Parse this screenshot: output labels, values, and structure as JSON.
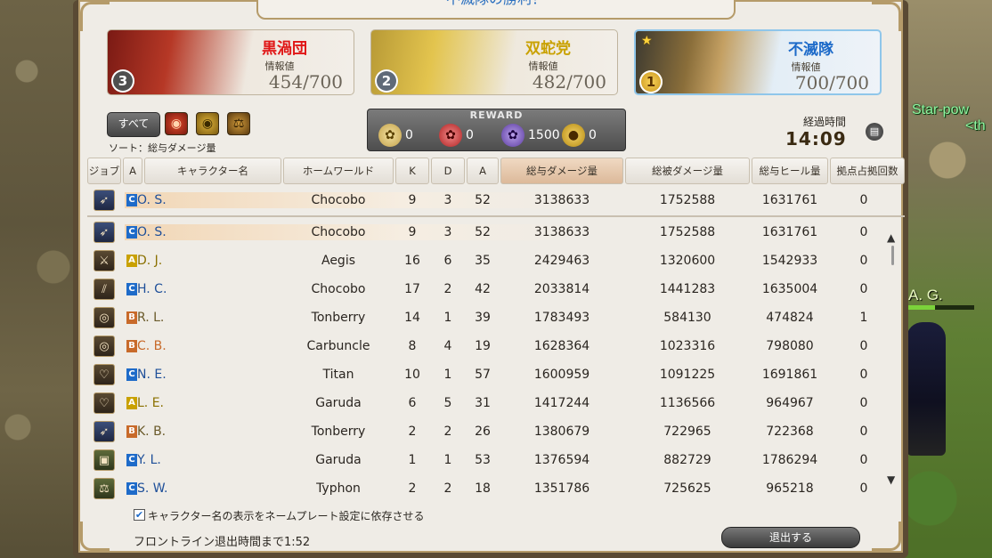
{
  "window": {
    "title": "不滅隊の勝利！"
  },
  "teams": [
    {
      "name": "黒渦団",
      "info_label": "情報値",
      "info_value": "454/700",
      "rank": "3",
      "emblem_icon": "flag-icon"
    },
    {
      "name": "双蛇党",
      "info_label": "情報値",
      "info_value": "482/700",
      "rank": "2",
      "emblem_icon": "flag-icon"
    },
    {
      "name": "不滅隊",
      "info_label": "情報値",
      "info_value": "700/700",
      "rank": "1",
      "emblem_icon": "flag-icon"
    }
  ],
  "filters": {
    "all_label": "すべて",
    "sort_label": "ソート：総与ダメージ量"
  },
  "reward": {
    "title": "REWARD",
    "items": [
      {
        "icon": "yellow-token-icon",
        "value": "0"
      },
      {
        "icon": "red-token-icon",
        "value": "0"
      },
      {
        "icon": "purple-token-icon",
        "value": "1500"
      },
      {
        "icon": "medal-icon",
        "value": "0"
      }
    ]
  },
  "elapsed": {
    "label": "経過時間",
    "time": "14:09"
  },
  "table": {
    "columns": [
      "ジョブ",
      "A",
      "キャラクター名",
      "ホームワールド",
      "K",
      "D",
      "A",
      "総与ダメージ量",
      "総被ダメージ量",
      "総与ヒール量",
      "拠点占拠回数"
    ],
    "pinned": {
      "job_icon": "bow-icon",
      "team": "C",
      "name": "O. S.",
      "world": "Chocobo",
      "k": "9",
      "d": "3",
      "a": "52",
      "dmg": "3138633",
      "taken": "1752588",
      "heal": "1631761",
      "capture": "0"
    },
    "rows": [
      {
        "job_icon": "bow-icon",
        "team": "C",
        "name": "O. S.",
        "world": "Chocobo",
        "k": "9",
        "d": "3",
        "a": "52",
        "dmg": "3138633",
        "taken": "1752588",
        "heal": "1631761",
        "capture": "0"
      },
      {
        "job_icon": "sword-icon",
        "team": "A",
        "name": "D. J.",
        "world": "Aegis",
        "k": "16",
        "d": "6",
        "a": "35",
        "dmg": "2429463",
        "taken": "1320600",
        "heal": "1542933",
        "capture": "0"
      },
      {
        "job_icon": "katana-icon",
        "team": "C",
        "name": "H. C.",
        "world": "Chocobo",
        "k": "17",
        "d": "2",
        "a": "42",
        "dmg": "2033814",
        "taken": "1441283",
        "heal": "1635004",
        "capture": "0"
      },
      {
        "job_icon": "chakram-icon",
        "team": "B",
        "name": "R. L.",
        "world": "Tonberry",
        "k": "14",
        "d": "1",
        "a": "39",
        "dmg": "1783493",
        "taken": "584130",
        "heal": "474824",
        "capture": "1"
      },
      {
        "job_icon": "chakram-icon",
        "team": "B",
        "name": "C. B.",
        "world": "Carbuncle",
        "k": "8",
        "d": "4",
        "a": "19",
        "dmg": "1628364",
        "taken": "1023316",
        "heal": "798080",
        "capture": "0"
      },
      {
        "job_icon": "shield-icon",
        "team": "C",
        "name": "N. E.",
        "world": "Titan",
        "k": "10",
        "d": "1",
        "a": "57",
        "dmg": "1600959",
        "taken": "1091225",
        "heal": "1691861",
        "capture": "0"
      },
      {
        "job_icon": "shield-icon",
        "team": "A",
        "name": "L. E.",
        "world": "Garuda",
        "k": "6",
        "d": "5",
        "a": "31",
        "dmg": "1417244",
        "taken": "1136566",
        "heal": "964967",
        "capture": "0"
      },
      {
        "job_icon": "bow-icon",
        "team": "B",
        "name": "K. B.",
        "world": "Tonberry",
        "k": "2",
        "d": "2",
        "a": "26",
        "dmg": "1380679",
        "taken": "722965",
        "heal": "722368",
        "capture": "0"
      },
      {
        "job_icon": "book-icon",
        "team": "C",
        "name": "Y. L.",
        "world": "Garuda",
        "k": "1",
        "d": "1",
        "a": "53",
        "dmg": "1376594",
        "taken": "882729",
        "heal": "1786294",
        "capture": "0"
      },
      {
        "job_icon": "scale-icon",
        "team": "C",
        "name": "S. W.",
        "world": "Typhon",
        "k": "2",
        "d": "2",
        "a": "18",
        "dmg": "1351786",
        "taken": "725625",
        "heal": "965218",
        "capture": "0"
      }
    ]
  },
  "footer": {
    "checkbox_label": "キャラクター名の表示をネームプレート設定に依存させる",
    "timer_text": "フロントライン退出時間まで1:52",
    "exit_label": "退出する"
  },
  "scene": {
    "floating_name_1": "Star-pow",
    "floating_name_2": "<th",
    "ally_label": "A. G."
  },
  "team_colors": {
    "A": "#c9a100",
    "B": "#c86a2a",
    "C": "#1e6bc9"
  }
}
